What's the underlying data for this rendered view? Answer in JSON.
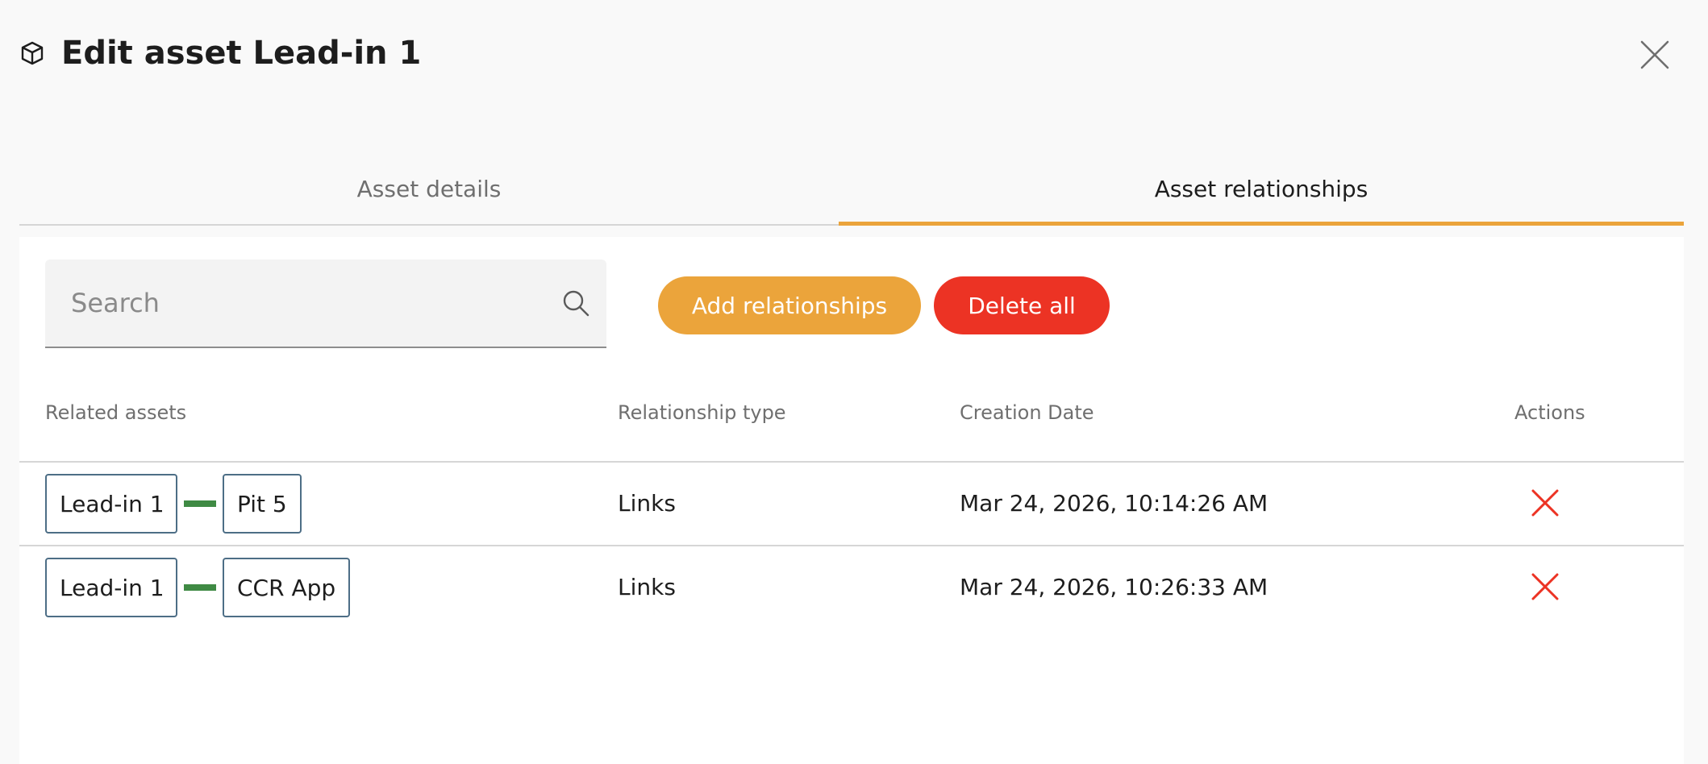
{
  "dialog": {
    "title": "Edit asset Lead-in 1",
    "title_icon": "cube-icon",
    "close_icon": "close-icon"
  },
  "tabs": [
    {
      "label": "Asset details",
      "active": false
    },
    {
      "label": "Asset relationships",
      "active": true
    }
  ],
  "toolbar": {
    "search_placeholder": "Search",
    "search_value": "",
    "add_label": "Add relationships",
    "delete_all_label": "Delete all"
  },
  "colors": {
    "accent": "#eba43b",
    "danger": "#ec3324",
    "link_connector": "#3f8a44",
    "chip_border": "#4d6e86"
  },
  "table": {
    "columns": [
      "Related assets",
      "Relationship type",
      "Creation Date",
      "Actions"
    ],
    "rows": [
      {
        "source": "Lead-in 1",
        "target": "Pit 5",
        "type": "Links",
        "created": "Mar 24, 2026, 10:14:26 AM"
      },
      {
        "source": "Lead-in 1",
        "target": "CCR App",
        "type": "Links",
        "created": "Mar 24, 2026, 10:26:33 AM"
      }
    ]
  }
}
